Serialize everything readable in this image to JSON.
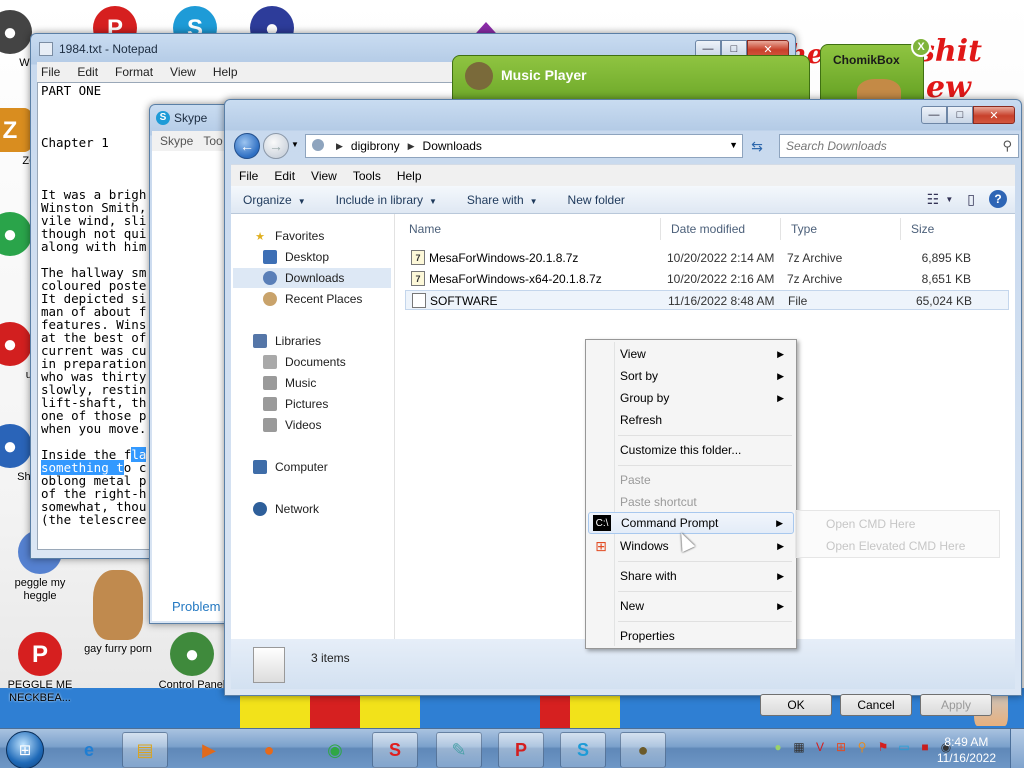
{
  "notepad": {
    "title": "1984.txt - Notepad",
    "menu": [
      "File",
      "Edit",
      "Format",
      "View",
      "Help"
    ],
    "lines": [
      "PART ONE",
      "",
      "",
      "",
      "Chapter 1",
      "",
      "",
      "",
      "It was a brigh",
      "Winston Smith,",
      "vile wind, sli",
      "though not qui",
      "along with him",
      "",
      "The hallway sm",
      "coloured poste",
      "It depicted si",
      "man of about f",
      "features. Wins",
      "at the best of",
      "current was cu",
      "in preparation",
      "who was thirty",
      "slowly, restin",
      "lift-shaft, th",
      "one of those p",
      "when you move.",
      ""
    ],
    "line_inside_plain": "Inside the f",
    "line_inside_sel": "la",
    "line_something_sel": "something t",
    "line_something_plain": "o c",
    "tail_lines": [
      "oblong metal p",
      "of the right-h",
      "somewhat, thou",
      "(the telescree"
    ]
  },
  "skype": {
    "title": "Skype",
    "menu": [
      "Skype",
      "Too"
    ],
    "problem_text": "Problem"
  },
  "music_player": {
    "title": "Music Player"
  },
  "chomikbox": {
    "title": "ChomikBox",
    "close": "X"
  },
  "graffiti": {
    "word1": "shit",
    "word2": "ew",
    "word3": "he"
  },
  "explorer": {
    "breadcrumb": [
      "digibrony",
      "Downloads"
    ],
    "search_placeholder": "Search Downloads",
    "menu": [
      "File",
      "Edit",
      "View",
      "Tools",
      "Help"
    ],
    "toolbar": {
      "organize": "Organize",
      "include": "Include in library",
      "share": "Share with",
      "new_folder": "New folder"
    },
    "nav": {
      "favorites": "Favorites",
      "desktop": "Desktop",
      "downloads": "Downloads",
      "recent": "Recent Places",
      "libraries": "Libraries",
      "documents": "Documents",
      "music": "Music",
      "pictures": "Pictures",
      "videos": "Videos",
      "computer": "Computer",
      "network": "Network"
    },
    "columns": {
      "name": "Name",
      "date": "Date modified",
      "type": "Type",
      "size": "Size"
    },
    "files": [
      {
        "name": "MesaForWindows-20.1.8.7z",
        "date": "10/20/2022 2:14 AM",
        "type": "7z Archive",
        "size": "6,895 KB"
      },
      {
        "name": "MesaForWindows-x64-20.1.8.7z",
        "date": "10/20/2022 2:16 AM",
        "type": "7z Archive",
        "size": "8,651 KB"
      },
      {
        "name": "SOFTWARE",
        "date": "11/16/2022 8:48 AM",
        "type": "File",
        "size": "65,024 KB"
      }
    ],
    "status": "3 items"
  },
  "context_menu": {
    "view": "View",
    "sort_by": "Sort by",
    "group_by": "Group by",
    "refresh": "Refresh",
    "customize": "Customize this folder...",
    "paste": "Paste",
    "paste_shortcut": "Paste shortcut",
    "command_prompt": "Command Prompt",
    "windows": "Windows",
    "share_with": "Share with",
    "new": "New",
    "properties": "Properties"
  },
  "submenu": {
    "open_cmd": "Open CMD Here",
    "open_elevated": "Open Elevated CMD Here"
  },
  "dialog_buttons": {
    "ok": "OK",
    "cancel": "Cancel",
    "apply": "Apply"
  },
  "desktop_icons": {
    "win": "WIN",
    "zo": "ZO",
    "ul": "ul",
    "shop": "Shop",
    "peggle_heggle": "peggle my heggle",
    "peggle_me": "PEGGLE ME NECKBEA...",
    "gay_furry": "gay furry porn",
    "control_panel": "Control Panel"
  },
  "taskbar": {
    "time": "8:49 AM",
    "date": "11/16/2022"
  },
  "colors": {
    "selection": "#3399ff",
    "window_frame": "#b4cbe6",
    "music_green": "#7bb331",
    "graffiti_red": "#e01818"
  }
}
